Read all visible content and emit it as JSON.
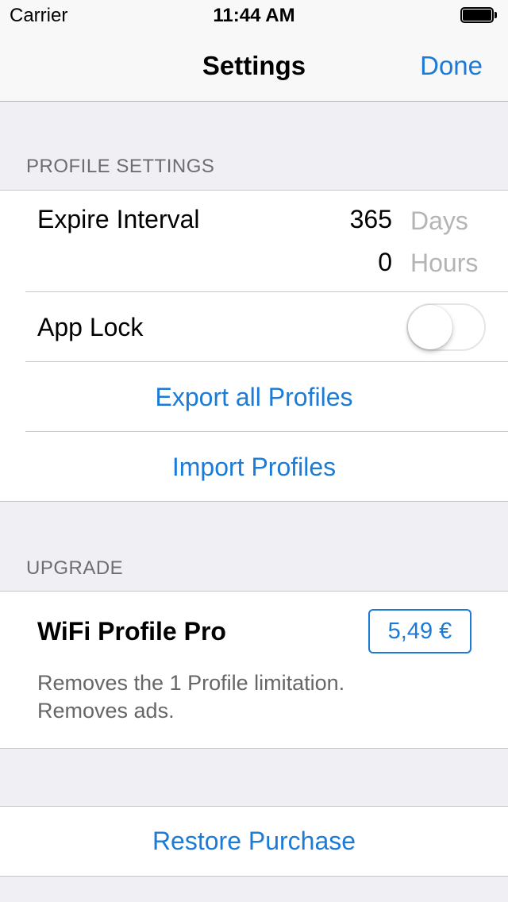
{
  "status_bar": {
    "carrier": "Carrier",
    "time": "11:44 AM",
    "battery_icon": "battery-full-icon"
  },
  "nav": {
    "title": "Settings",
    "done_label": "Done"
  },
  "profile_settings": {
    "header": "PROFILE SETTINGS",
    "expire_interval": {
      "label": "Expire Interval",
      "days_value": "365",
      "days_unit": "Days",
      "hours_value": "0",
      "hours_unit": "Hours"
    },
    "app_lock": {
      "label": "App Lock",
      "enabled": false
    },
    "export_label": "Export all Profiles",
    "import_label": "Import Profiles"
  },
  "upgrade": {
    "header": "UPGRADE",
    "product_name": "WiFi Profile Pro",
    "price": "5,49 €",
    "description_line1": "Removes the 1 Profile limitation.",
    "description_line2": "Removes ads."
  },
  "restore": {
    "label": "Restore Purchase"
  },
  "colors": {
    "accent": "#1b7bd6",
    "background": "#efeff4",
    "separator": "#c8c7cc",
    "secondary_text": "#6d6d72"
  }
}
